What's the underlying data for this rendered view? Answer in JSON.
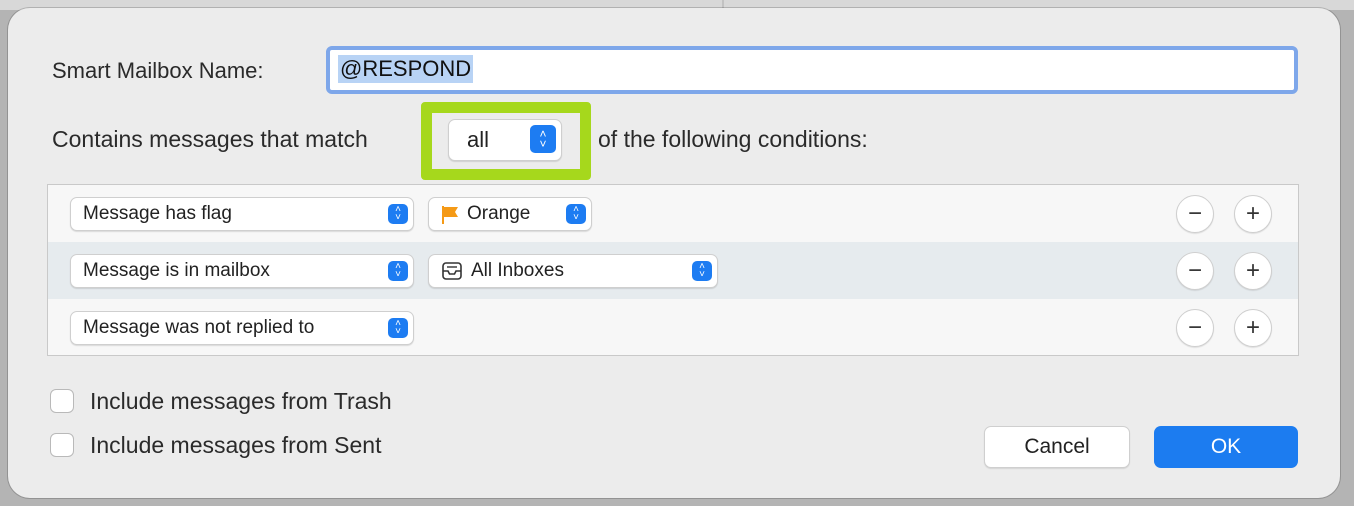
{
  "dialog": {
    "name_label": "Smart Mailbox Name:",
    "name_value": "@RESPOND",
    "match_prefix": "Contains messages that match",
    "match_value": "all",
    "match_suffix": "of the following conditions:",
    "conditions": [
      {
        "field": "Message has flag",
        "value": "Orange",
        "value_icon": "flag-icon"
      },
      {
        "field": "Message is in mailbox",
        "value": "All Inboxes",
        "value_icon": "inbox-icon"
      },
      {
        "field": "Message was not replied to",
        "value": "",
        "value_icon": ""
      }
    ],
    "remove_glyph": "−",
    "add_glyph": "+",
    "stepper_glyph_up": "˄",
    "stepper_glyph_down": "˅",
    "include_trash": "Include messages from Trash",
    "include_sent": "Include messages from Sent",
    "cancel_label": "Cancel",
    "ok_label": "OK"
  },
  "colors": {
    "accent": "#1c7cf0",
    "highlight": "#a6d81c",
    "flag_orange": "#f59a16"
  }
}
